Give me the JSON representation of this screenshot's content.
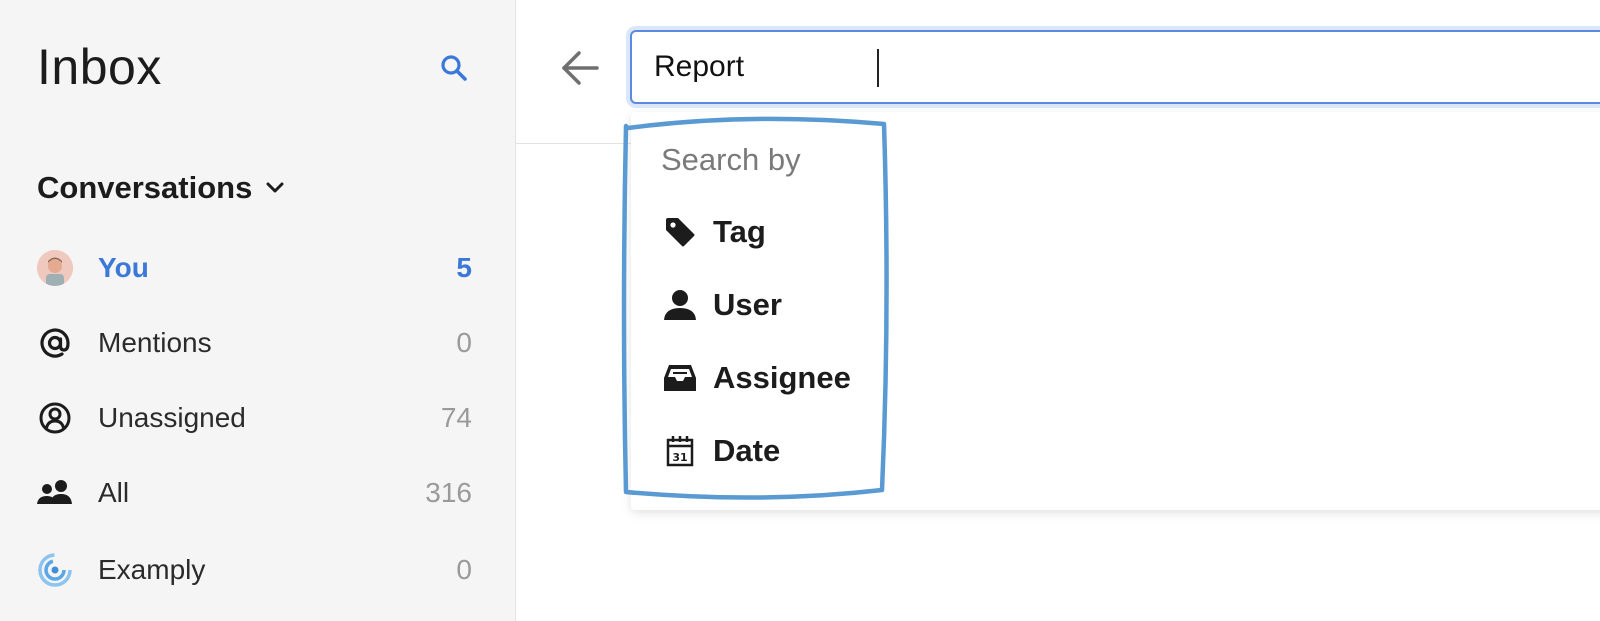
{
  "sidebar": {
    "title": "Inbox",
    "section_label": "Conversations",
    "items": [
      {
        "label": "You",
        "count": "5"
      },
      {
        "label": "Mentions",
        "count": "0"
      },
      {
        "label": "Unassigned",
        "count": "74"
      },
      {
        "label": "All",
        "count": "316"
      },
      {
        "label": "Examply",
        "count": "0"
      }
    ]
  },
  "search": {
    "value": "Report",
    "accent": "#3c78d8"
  },
  "dropdown": {
    "header": "Search by",
    "items": [
      {
        "label": "Tag",
        "icon": "tag-icon"
      },
      {
        "label": "User",
        "icon": "user-icon"
      },
      {
        "label": "Assignee",
        "icon": "inbox-tray-icon"
      },
      {
        "label": "Date",
        "icon": "calendar-icon"
      }
    ]
  },
  "colors": {
    "accent_blue": "#3c78d8",
    "annotation_blue": "#5a9ad2",
    "sidebar_bg": "#f5f5f5"
  }
}
